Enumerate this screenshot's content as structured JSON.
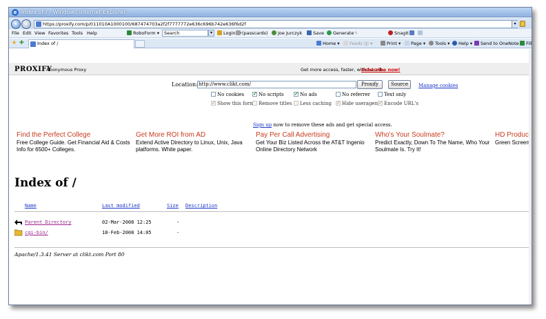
{
  "window": {
    "title": "Index of / - Windows Internet Explorer"
  },
  "address": {
    "url": "https://proxify.com/p/011010A1000100/687474703a2f2f7777772e636c696b742e636f6d2f"
  },
  "menu": {
    "items": [
      "File",
      "Edit",
      "View",
      "Favorites",
      "Tools",
      "Help"
    ]
  },
  "toolbar": {
    "roboform": "RoboForm",
    "search_placeholder": "Search",
    "logins": "Logins",
    "passcards": "(passcards)",
    "user": "Joe Jurczyk",
    "save": "Save",
    "generate": "Generate",
    "snagit": "SnagIt"
  },
  "tabs": {
    "active_label": "Index of /",
    "home": "Home",
    "feeds": "Feeds (J)",
    "print": "Print",
    "page": "Page",
    "tools": "Tools",
    "help": "Help",
    "send_onenote": "Send to OneNote",
    "fill": "Fill F"
  },
  "proxy": {
    "logo": "PROXIFY",
    "subtitle": "Anonymous Proxy",
    "more_access": "Get more access, faster, without ads.",
    "subscribe": "Subscribe now!",
    "location_label": "Location:",
    "location_value": "http://www.clikt.com/",
    "proxify_btn": "Proxify",
    "source_btn": "Source",
    "manage_cookies": "Manage cookies",
    "options": [
      {
        "label": "No cookies",
        "checked": false,
        "disabled": false
      },
      {
        "label": "No scripts",
        "checked": true,
        "disabled": false
      },
      {
        "label": "No ads",
        "checked": true,
        "disabled": false
      },
      {
        "label": "No referrer",
        "checked": false,
        "disabled": false
      },
      {
        "label": "Text only",
        "checked": false,
        "disabled": false
      },
      {
        "label": "Show this form",
        "checked": true,
        "disabled": true
      },
      {
        "label": "Remove titles",
        "checked": false,
        "disabled": true
      },
      {
        "label": "Less caching",
        "checked": false,
        "disabled": true
      },
      {
        "label": "Hide useragent",
        "checked": true,
        "disabled": true
      },
      {
        "label": "Encode URL's",
        "checked": true,
        "disabled": true
      }
    ],
    "signup_link": "Sign up",
    "signup_rest": "now to remove these ads and get special access."
  },
  "ads": [
    {
      "title": "Find the Perfect College",
      "desc": "Free College Guide. Get Financial Aid & Costs Info for 6500+ Colleges."
    },
    {
      "title": "Get More ROI from AD",
      "desc": "Extend Active Directory to Linux, Unix, Java platforms. White paper."
    },
    {
      "title": "Pay Per Call Advertising",
      "desc": "Get Your Biz Listed Across the AT&T Ingenio Online Directory Network"
    },
    {
      "title": "Who's Your Soulmate?",
      "desc": "Predict Exactly, Down To The Name, Who Your Soulmate Is. Try It!"
    },
    {
      "title": "HD Produc",
      "desc": "Green Screen Production H"
    }
  ],
  "index": {
    "title": "Index of /",
    "columns": {
      "name": "Name",
      "modified": "Last modified",
      "size": "Size",
      "description": "Description"
    },
    "rows": [
      {
        "name": "Parent Directory",
        "modified": "02-Mar-2008 12:25",
        "size": "-",
        "icon": "back-arrow-icon"
      },
      {
        "name": "cgi-bin/",
        "modified": "18-Feb-2008 14:05",
        "size": "-",
        "icon": "folder-icon"
      }
    ],
    "signature": "Apache/1.3.41 Server at clikt.com Port 80"
  }
}
